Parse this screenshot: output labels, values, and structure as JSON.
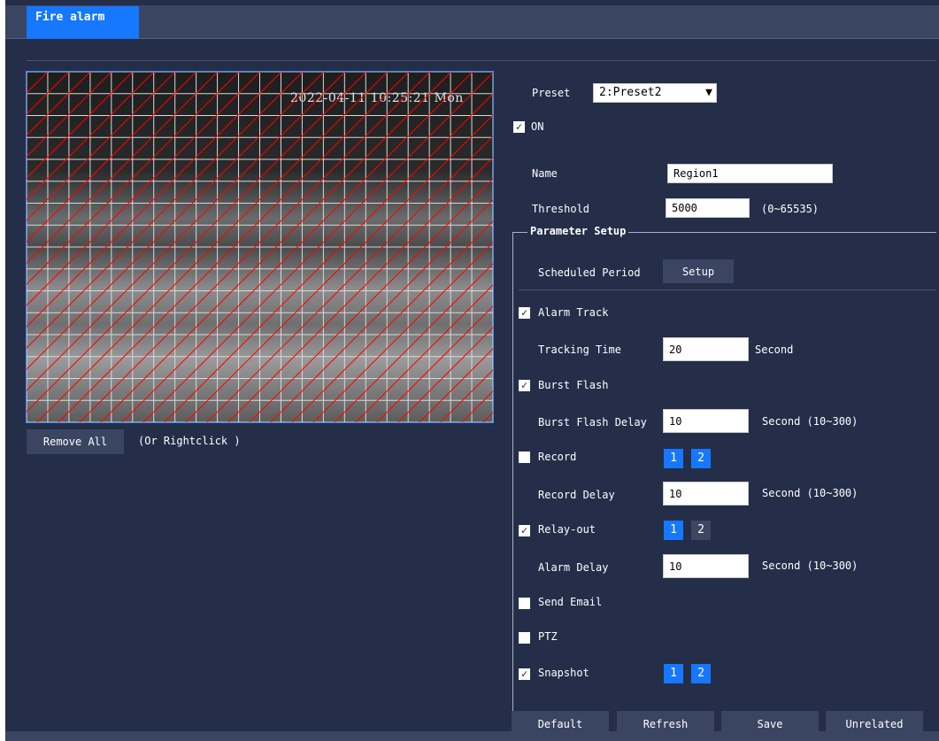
{
  "tab": {
    "label": "Fire alarm"
  },
  "preview": {
    "timestamp": "2022-04-11 10:25:21 Mon"
  },
  "region_controls": {
    "remove_all": "Remove All",
    "hint": "(Or Rightclick )"
  },
  "preset": {
    "label": "Preset",
    "value": "2:Preset2"
  },
  "on": {
    "label": "ON",
    "checked": true
  },
  "name": {
    "label": "Name",
    "value": "Region1"
  },
  "threshold": {
    "label": "Threshold",
    "value": "5000",
    "range": "(0~65535)"
  },
  "parameter_setup": {
    "title": "Parameter Setup",
    "scheduled_period": {
      "label": "Scheduled Period",
      "button": "Setup"
    },
    "alarm_track": {
      "label": "Alarm Track",
      "checked": true
    },
    "tracking_time": {
      "label": "Tracking Time",
      "value": "20",
      "unit": "Second"
    },
    "burst_flash": {
      "label": "Burst Flash",
      "checked": true
    },
    "burst_flash_delay": {
      "label": "Burst Flash Delay",
      "value": "10",
      "unit": "Second (10~300)"
    },
    "record": {
      "label": "Record",
      "checked": false,
      "channels": [
        "1",
        "2"
      ]
    },
    "record_delay": {
      "label": "Record Delay",
      "value": "10",
      "unit": "Second (10~300)"
    },
    "relay_out": {
      "label": "Relay-out",
      "checked": true,
      "channels": [
        "1",
        "2"
      ]
    },
    "alarm_delay": {
      "label": "Alarm Delay",
      "value": "10",
      "unit": "Second (10~300)"
    },
    "send_email": {
      "label": "Send Email",
      "checked": false
    },
    "ptz": {
      "label": "PTZ",
      "checked": false
    },
    "snapshot": {
      "label": "Snapshot",
      "checked": true,
      "channels": [
        "1",
        "2"
      ]
    }
  },
  "footer": {
    "default": "Default",
    "refresh": "Refresh",
    "save": "Save",
    "unrelated": "Unrelated"
  },
  "colors": {
    "background": "#242e49",
    "accent": "#1677ff",
    "button": "#3a4562",
    "grid": "#ff0000"
  }
}
